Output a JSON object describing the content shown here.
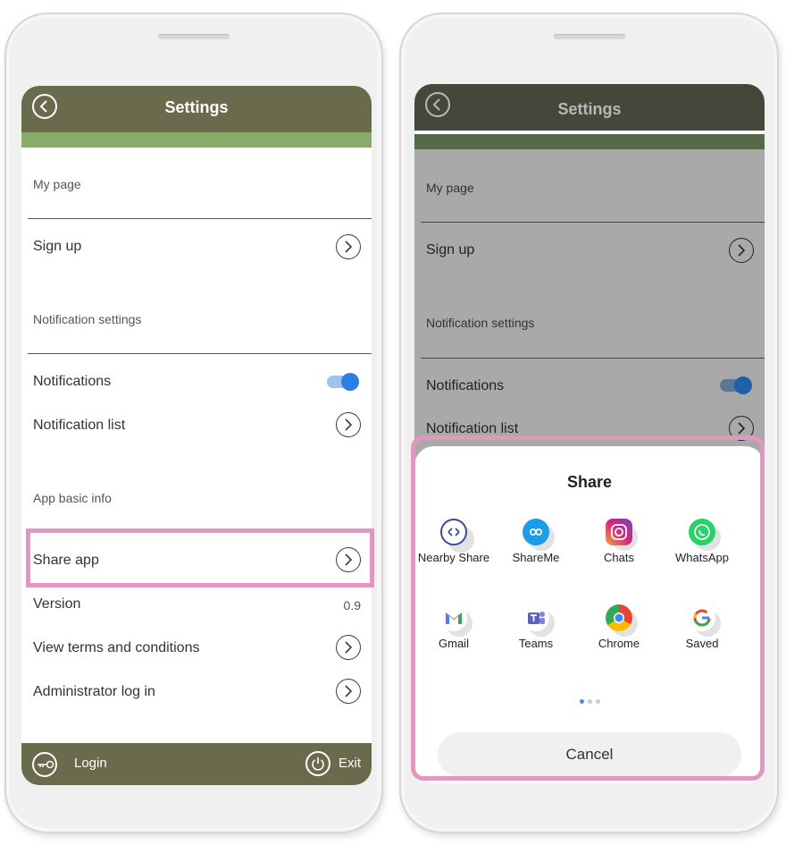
{
  "settings": {
    "title": "Settings",
    "sections": {
      "my_page": "My page",
      "notification_settings": "Notification settings",
      "app_basic_info": "App basic info"
    },
    "rows": {
      "sign_up": "Sign up",
      "notifications": "Notifications",
      "notification_list": "Notification list",
      "share_app": "Share app",
      "version": "Version",
      "version_value": "0.9",
      "view_terms": "View terms and conditions",
      "admin_login": "Administrator log in"
    },
    "notifications_enabled": true,
    "bottombar": {
      "login": "Login",
      "exit": "Exit"
    }
  },
  "share_sheet": {
    "title": "Share",
    "apps": [
      {
        "label": "Nearby Share",
        "icon": "nearby-share-icon",
        "color": "#3b4a9c"
      },
      {
        "label": "ShareMe",
        "icon": "shareme-icon",
        "color": "#1a9ee8"
      },
      {
        "label": "Chats",
        "icon": "instagram-icon",
        "color": "#d6287a"
      },
      {
        "label": "WhatsApp",
        "icon": "whatsapp-icon",
        "color": "#25d366"
      },
      {
        "label": "Gmail",
        "icon": "gmail-icon",
        "color": "#ea4335"
      },
      {
        "label": "Teams",
        "icon": "teams-icon",
        "color": "#5b5fc7"
      },
      {
        "label": "Chrome",
        "icon": "chrome-icon",
        "color": "#4285f4"
      },
      {
        "label": "Saved",
        "icon": "google-icon",
        "color": "#4285f4"
      }
    ],
    "page_count": 3,
    "active_page": 1,
    "cancel": "Cancel"
  },
  "colors": {
    "header": "#696b4c",
    "accent_strip": "#8aac6a",
    "highlight": "#e596bf",
    "toggle": "#2b7fde"
  }
}
